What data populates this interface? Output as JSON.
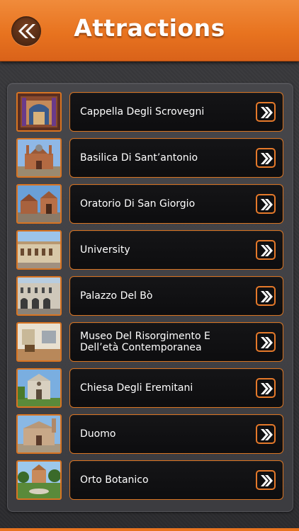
{
  "header": {
    "title": "Attractions",
    "back_icon": "double-chevron-left-icon",
    "accent_color": "#e8731f"
  },
  "list": {
    "items": [
      {
        "label": "Cappella Degli Scrovegni"
      },
      {
        "label": "Basilica Di Sant’antonio"
      },
      {
        "label": "Oratorio Di San Giorgio"
      },
      {
        "label": "University"
      },
      {
        "label": "Palazzo Del Bò"
      },
      {
        "label": "Museo Del Risorgimento E Dell’età Contemporanea"
      },
      {
        "label": "Chiesa Degli Eremitani"
      },
      {
        "label": "Duomo"
      },
      {
        "label": "Orto Botanico"
      }
    ],
    "arrow_icon": "double-chevron-right-icon"
  }
}
